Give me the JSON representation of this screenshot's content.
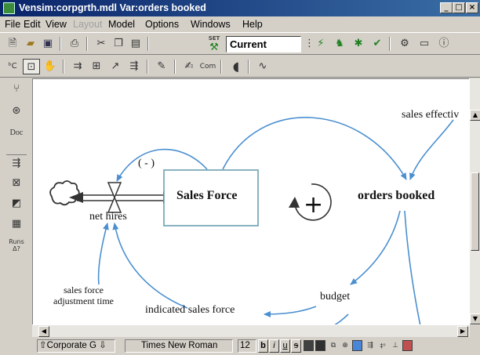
{
  "window": {
    "title": "Vensim:corpgrth.mdl Var:orders booked",
    "controls": [
      "_",
      "□",
      "×"
    ]
  },
  "menu": {
    "items": [
      "File",
      "Edit",
      "View",
      "Layout",
      "Model",
      "Options",
      "Windows",
      "Help"
    ],
    "disabled": [
      "Layout"
    ]
  },
  "toolbar": {
    "set_label": "SET",
    "run_name": "Current",
    "icons": [
      "new-file-icon",
      "open-folder-icon",
      "save-icon",
      "print-icon",
      "cut-icon",
      "copy-icon",
      "paste-icon",
      "set-run-icon",
      "simulate-icon",
      "gaming-icon",
      "synthsim-icon",
      "reality-check-icon",
      "control-panel-icon",
      "output-window-icon",
      "help-icon"
    ]
  },
  "sketch_tools": {
    "icons": [
      "variable-tool-icon",
      "box-variable-tool-icon",
      "lock-tool-icon",
      "rate-tool-icon",
      "shadow-variable-tool-icon",
      "arrow-tool-icon",
      "flow-tool-icon",
      "comment-tool-icon",
      "delete-tool-icon",
      "equations-tool-icon",
      "sketch-comment-icon",
      "reference-mode-icon",
      "unhide-wand-icon"
    ],
    "equations_glyph": "Com"
  },
  "palette": {
    "items": [
      "causes-tree",
      "uses-tree",
      "Doc",
      "loops",
      "graph",
      "table",
      "runs-compare"
    ],
    "doc_label": "Doc",
    "runs_label": "Runs\nΔ?"
  },
  "diagram": {
    "variables": {
      "sales_effectiveness": "sales effectiv",
      "orders_booked": "orders booked",
      "sales_force": "Sales Force",
      "net_hires": "net hires",
      "budget": "budget",
      "indicated_sales_force": "indicated sales force",
      "adjustment_time": "sales force\nadjustment time"
    },
    "loop_polarity_negative": "( - )",
    "loop_polarity_positive": "+"
  },
  "statusbar": {
    "view": "Corporate G",
    "font": "Times New Roman",
    "size": "12",
    "format_buttons": [
      "b",
      "i",
      "u",
      "s"
    ],
    "colors": {
      "text": "#404040",
      "fill": "#303030",
      "highlight": "#4a86d8",
      "pick": "#c05050"
    }
  },
  "colors": {
    "titlebar_start": "#0a246a",
    "titlebar_end": "#3a6ea5",
    "diagram_arrow": "#4a8fd0",
    "stock_border": "#6aa0b0"
  }
}
